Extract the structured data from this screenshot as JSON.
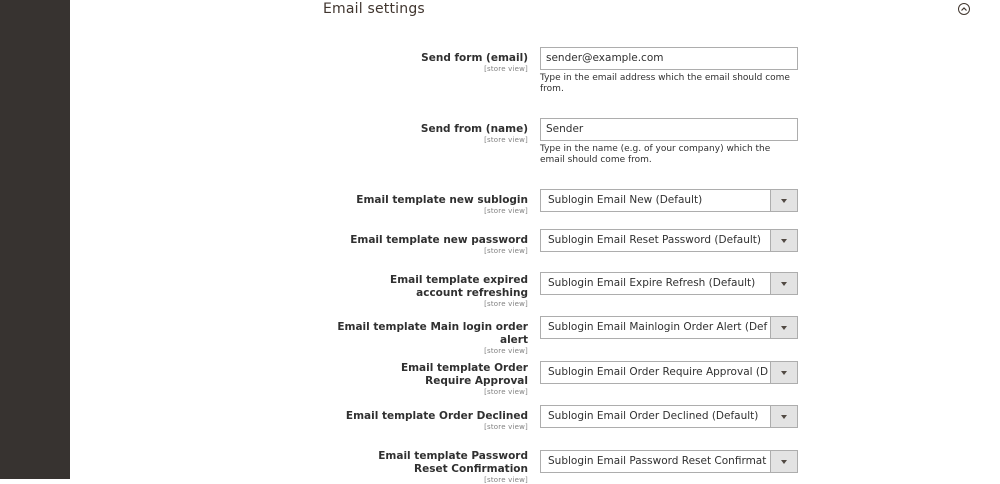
{
  "section": {
    "title": "Email settings"
  },
  "fields": {
    "send_form_email": {
      "label": "Send form (email)",
      "scope": "[store view]",
      "value": "sender@example.com",
      "note": "Type in the email address which the email should come from."
    },
    "send_from_name": {
      "label": "Send from (name)",
      "scope": "[store view]",
      "value": "Sender",
      "note": "Type in the name (e.g. of your company) which the email should come from."
    },
    "tpl_new_sublogin": {
      "label": "Email template new sublogin",
      "scope": "[store view]",
      "value": "Sublogin Email New (Default)"
    },
    "tpl_new_password": {
      "label": "Email template new password",
      "scope": "[store view]",
      "value": "Sublogin Email Reset Password (Default)"
    },
    "tpl_expired_refreshing": {
      "label": "Email template expired account refreshing",
      "scope": "[store view]",
      "value": "Sublogin Email Expire Refresh (Default)"
    },
    "tpl_main_login_order_alert": {
      "label": "Email template Main login order alert",
      "scope": "[store view]",
      "value": "Sublogin Email Mainlogin Order Alert (Def"
    },
    "tpl_order_require_approval": {
      "label": "Email template Order Require Approval",
      "scope": "[store view]",
      "value": "Sublogin Email Order Require Approval (D"
    },
    "tpl_order_declined": {
      "label": "Email template Order Declined",
      "scope": "[store view]",
      "value": "Sublogin Email Order Declined (Default)"
    },
    "tpl_password_reset_confirmation": {
      "label": "Email template Password Reset Confirmation",
      "scope": "[store view]",
      "value": "Sublogin Email Password Reset Confirmat"
    }
  },
  "icons": {
    "collapse": "chevron-up-circle-icon",
    "dropdown": "caret-down-icon"
  },
  "colors": {
    "sidebar": "#373330",
    "field_border": "#adadad",
    "select_button": "#e3e3e3"
  }
}
